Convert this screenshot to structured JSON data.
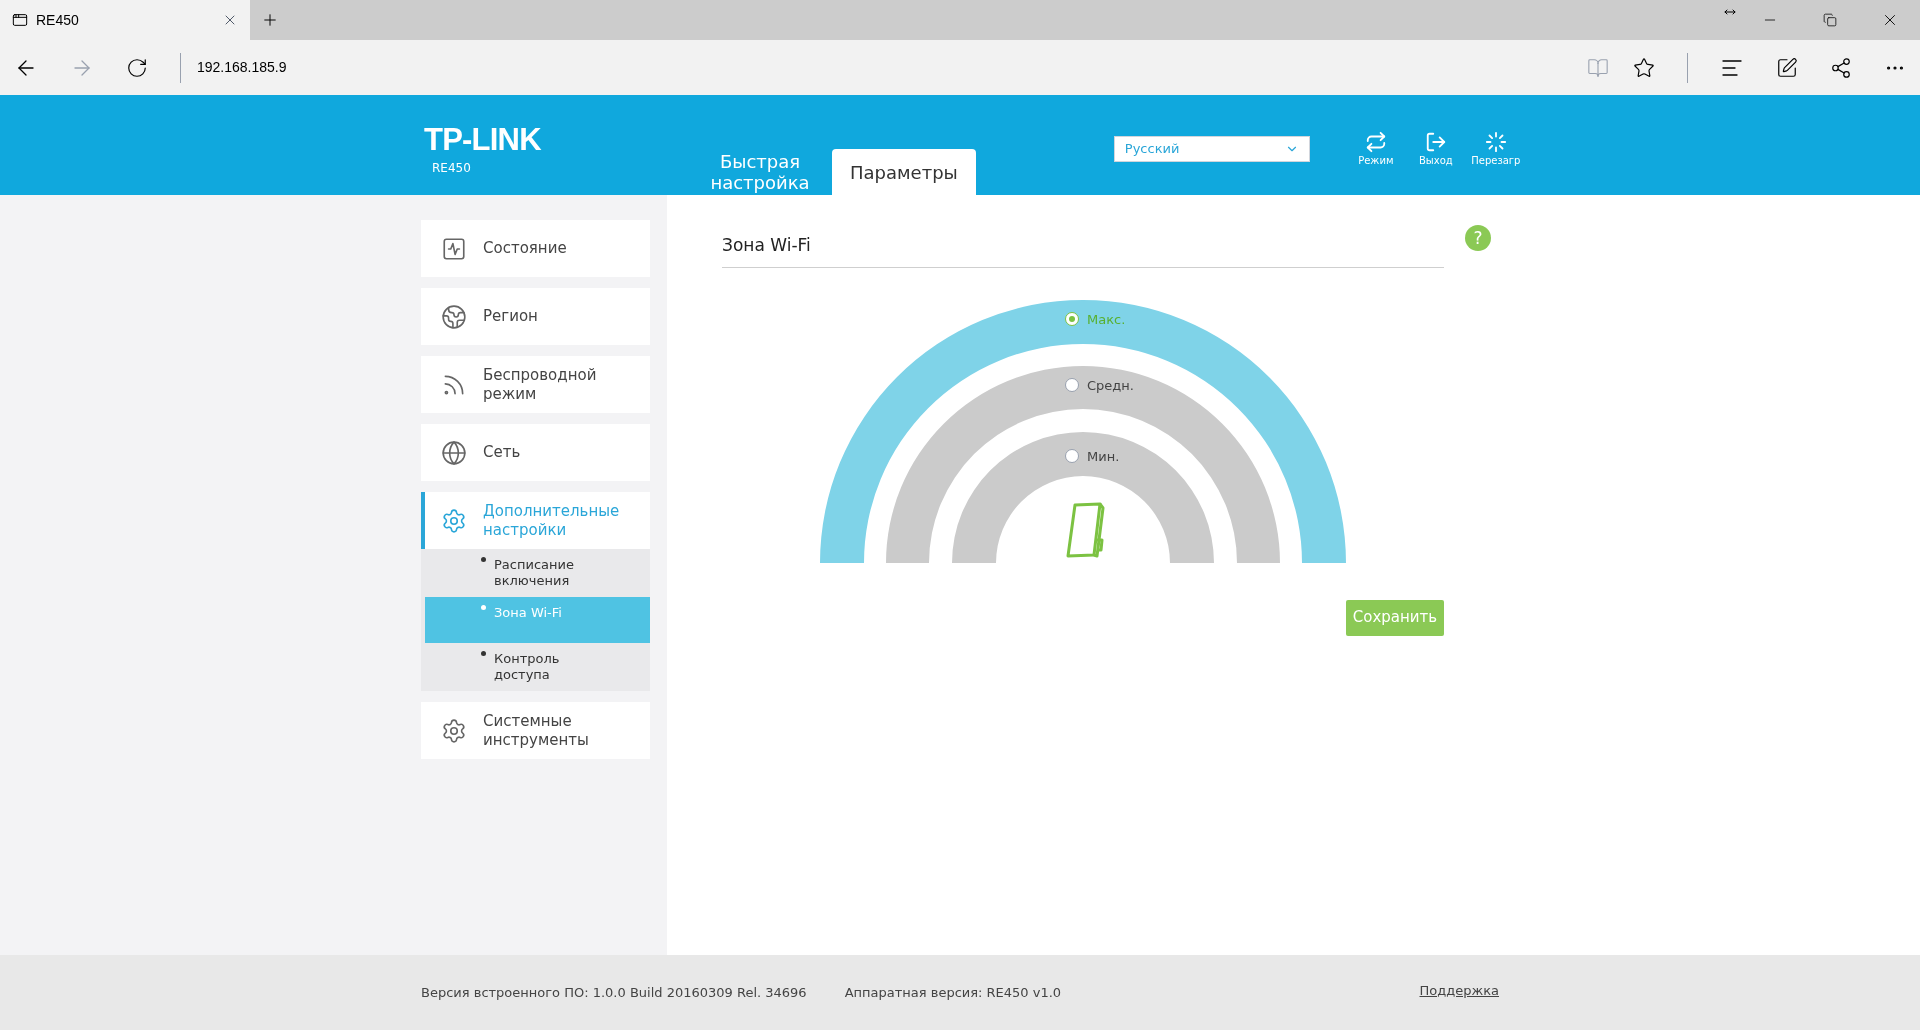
{
  "browser": {
    "tab_title": "RE450",
    "address": "192.168.185.9"
  },
  "header": {
    "logo": "TP-LINK",
    "model": "RE450",
    "nav_tabs": [
      {
        "label": "Быстрая настройка",
        "selected": false
      },
      {
        "label": "Параметры",
        "selected": true
      }
    ],
    "language": "Русский",
    "actions": [
      {
        "label": "Режим"
      },
      {
        "label": "Выход"
      },
      {
        "label": "Перезагр"
      }
    ]
  },
  "sidebar": {
    "items": [
      {
        "label": "Состояние",
        "selected": false
      },
      {
        "label": "Регион",
        "selected": false
      },
      {
        "label": "Беспроводной режим",
        "selected": false
      },
      {
        "label": "Сеть",
        "selected": false
      },
      {
        "label": "Дополнительные настройки",
        "selected": true,
        "children": [
          {
            "label": "Расписание включения",
            "selected": false
          },
          {
            "label": "Зона Wi-Fi",
            "selected": true
          },
          {
            "label": "Контроль доступа",
            "selected": false
          }
        ]
      },
      {
        "label": "Системные инструменты",
        "selected": false
      }
    ]
  },
  "content": {
    "title": "Зона Wi-Fi",
    "help": "?",
    "options": [
      {
        "label": "Макс.",
        "selected": true
      },
      {
        "label": "Средн.",
        "selected": false
      },
      {
        "label": "Мин.",
        "selected": false
      }
    ],
    "save_button": "Сохранить"
  },
  "footer": {
    "firmware": "Версия встроенного ПО: 1.0.0 Build 20160309 Rel. 34696",
    "hardware": "Аппаратная версия: RE450 v1.0",
    "support_link": "Поддержка"
  }
}
